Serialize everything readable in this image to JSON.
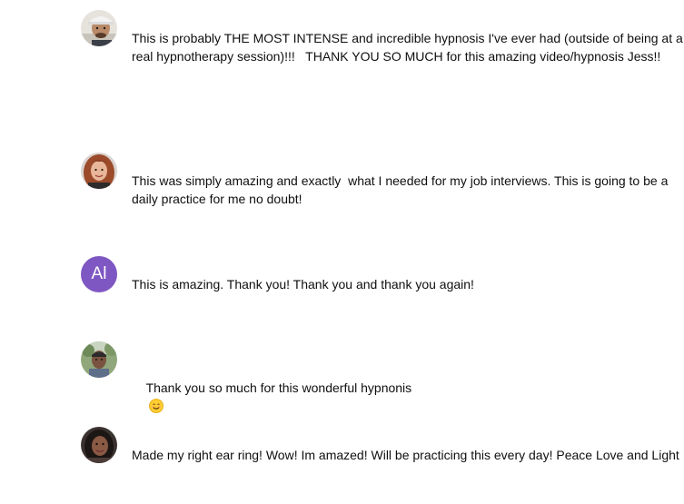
{
  "comments": [
    {
      "avatar": "avatar-man-cap",
      "text": "This is probably THE MOST INTENSE and incredible hypnosis I've ever had (outside of being at a real hypnotherapy session)!!!   THANK YOU SO MUCH for this amazing video/hypnosis Jess!!"
    },
    {
      "avatar": "avatar-woman-redhair",
      "text": "This was simply amazing and exactly  what I needed for my job interviews. This is going to be a daily practice for me no doubt!"
    },
    {
      "avatar": "avatar-initials",
      "initials": "Al",
      "avatar_color": "#7e57c2",
      "text": "This is amazing. Thank you! Thank you and thank you again!"
    },
    {
      "avatar": "avatar-man-outdoors",
      "text": "Thank you so much for this wonderful hypnonis",
      "emoji": "smiling-face-icon"
    },
    {
      "avatar": "avatar-woman-dark",
      "text": "Made my right ear ring! Wow! Im amazed! Will be practicing this every day! Peace Love and Light"
    }
  ]
}
